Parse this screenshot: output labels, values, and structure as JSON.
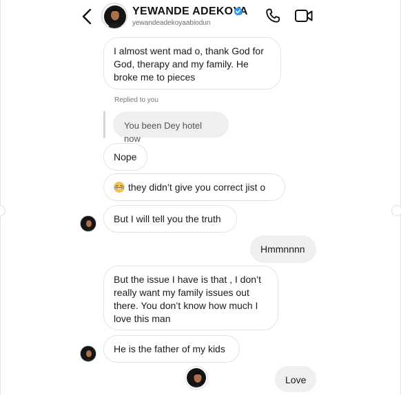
{
  "header": {
    "name": "YEWANDE ADEKOYA",
    "handle": "yewandeadekoyaabiodun",
    "verified": true
  },
  "icons": {
    "back": "chevron-left-icon",
    "call": "phone-icon",
    "video": "video-camera-icon",
    "verified": "verified-badge-icon",
    "laugh": "laughing-tears-emoji"
  },
  "colors": {
    "verified_blue": "#3897f0",
    "incoming_bubble": "#ffffff",
    "outgoing_bubble": "#efefef",
    "bubble_border": "#e3e3e3"
  },
  "messages": {
    "m1": "I almost went mad o, thank God for\nGod, therapy and my family. He\nbroke me to pieces",
    "replied_label": "Replied to you",
    "reply_quote": "You been Dey hotel now",
    "m2": "Nope",
    "m3": "they didn’t give you correct jist o",
    "m4": "But I will tell you the truth",
    "m5": "Hmmnnnn",
    "m6": "But the issue I have is that , I don’t\nreally want my family issues out\nthere. You don’t know how much I\nlove this man",
    "m7": "He is the father of my kids",
    "m8": "Love"
  }
}
